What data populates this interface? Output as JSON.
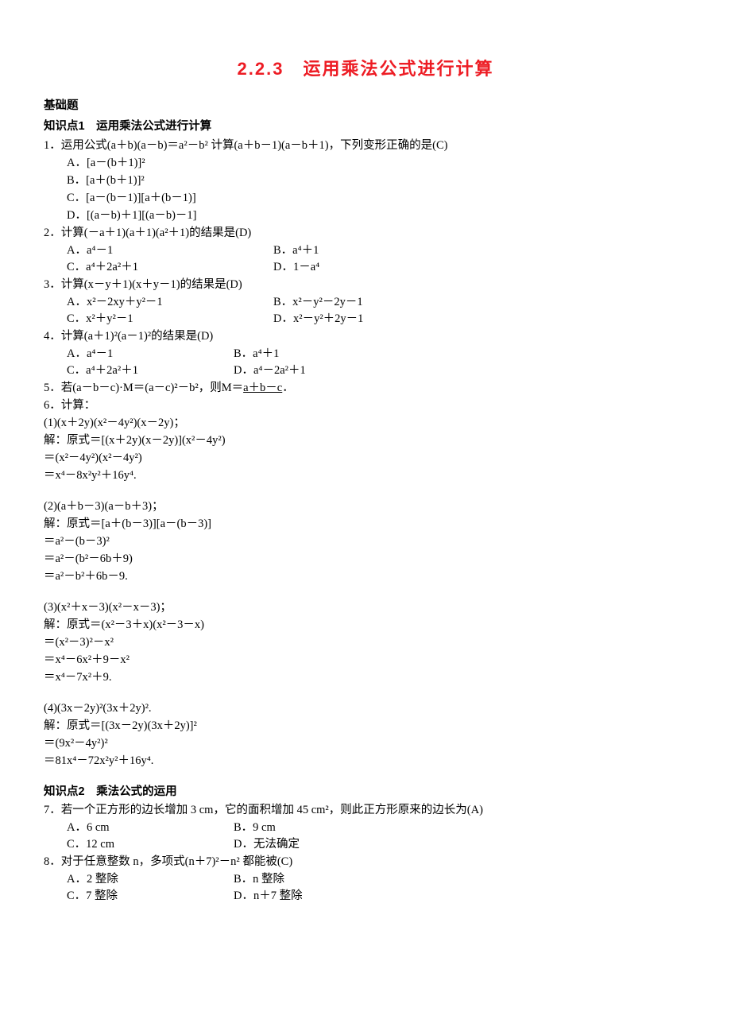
{
  "title": "2.2.3　运用乘法公式进行计算",
  "s1_title": "基础题",
  "kp1_title": "知识点1　运用乘法公式进行计算",
  "q1": "1．运用公式(a＋b)(a－b)＝a²－b² 计算(a＋b－1)(a－b＋1)，下列变形正确的是(C)",
  "q1a": "A．[a－(b＋1)]²",
  "q1b": "B．[a＋(b＋1)]²",
  "q1c": "C．[a－(b－1)][a＋(b－1)]",
  "q1d": "D．[(a－b)＋1][(a－b)－1]",
  "q2": "2．计算(－a＋1)(a＋1)(a²＋1)的结果是(D)",
  "q2a": "A．a⁴－1",
  "q2b": "B．a⁴＋1",
  "q2c": "C．a⁴＋2a²＋1",
  "q2d": "D．1－a⁴",
  "q3": "3．计算(x－y＋1)(x＋y－1)的结果是(D)",
  "q3a": "A．x²－2xy＋y²－1",
  "q3b": "B．x²－y²－2y－1",
  "q3c": "C．x²＋y²－1",
  "q3d": "D．x²－y²＋2y－1",
  "q4": "4．计算(a＋1)²(a－1)²的结果是(D)",
  "q4a": "A．a⁴－1",
  "q4b": "B．a⁴＋1",
  "q4c": "C．a⁴＋2a²＋1",
  "q4d": "D．a⁴－2a²＋1",
  "q5_pre": "5．若(a－b－c)·M＝(a－c)²－b²，则M＝",
  "q5_ans": "a＋b－c",
  "q5_post": "．",
  "q6": "6．计算：",
  "q6_1": "(1)(x＋2y)(x²－4y²)(x－2y)；",
  "q6_1s1": "解：原式＝[(x＋2y)(x－2y)](x²－4y²)",
  "q6_1s2": "＝(x²－4y²)(x²－4y²)",
  "q6_1s3": "＝x⁴－8x²y²＋16y⁴.",
  "q6_2": "(2)(a＋b－3)(a－b＋3)；",
  "q6_2s1": "解：原式＝[a＋(b－3)][a－(b－3)]",
  "q6_2s2": "＝a²－(b－3)²",
  "q6_2s3": "＝a²－(b²－6b＋9)",
  "q6_2s4": "＝a²－b²＋6b－9.",
  "q6_3": "(3)(x²＋x－3)(x²－x－3)；",
  "q6_3s1": "解：原式＝(x²－3＋x)(x²－3－x)",
  "q6_3s2": "＝(x²－3)²－x²",
  "q6_3s3": "＝x⁴－6x²＋9－x²",
  "q6_3s4": "＝x⁴－7x²＋9.",
  "q6_4": "(4)(3x－2y)²(3x＋2y)².",
  "q6_4s1": "解：原式＝[(3x－2y)(3x＋2y)]²",
  "q6_4s2": "＝(9x²－4y²)²",
  "q6_4s3": "＝81x⁴－72x²y²＋16y⁴.",
  "kp2_title": "知识点2　乘法公式的运用",
  "q7": "7．若一个正方形的边长增加 3 cm，它的面积增加 45 cm²，则此正方形原来的边长为(A)",
  "q7a": "A．6 cm",
  "q7b": "B．9 cm",
  "q7c": "C．12 cm",
  "q7d": "D．无法确定",
  "q8": "8．对于任意整数 n，多项式(n＋7)²－n² 都能被(C)",
  "q8a": "A．2 整除",
  "q8b": "B．n 整除",
  "q8c": "C．7 整除",
  "q8d": "D．n＋7 整除"
}
